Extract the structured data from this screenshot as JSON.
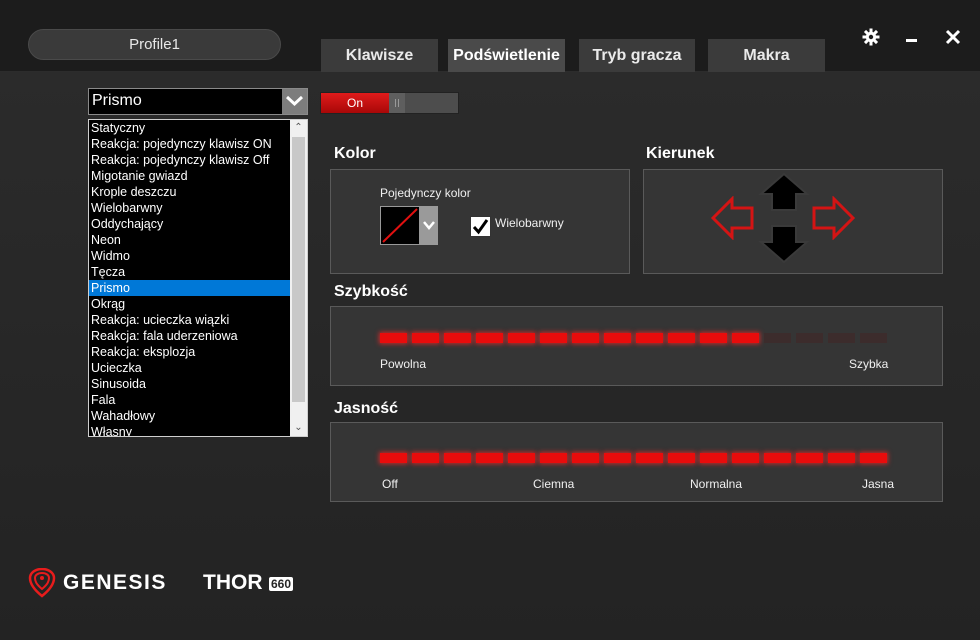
{
  "header": {
    "profile_label": "Profile1",
    "tabs": [
      {
        "label": "Klawisze",
        "active": false
      },
      {
        "label": "Podświetlenie",
        "active": true
      },
      {
        "label": "Tryb gracza",
        "active": false
      },
      {
        "label": "Makra",
        "active": false
      }
    ],
    "window_controls": {
      "settings_icon": "gear-icon",
      "minimize_icon": "minimize-icon",
      "close_icon": "close-icon"
    }
  },
  "effect_select": {
    "value": "Prismo",
    "options": [
      "Statyczny",
      "Reakcja: pojedynczy klawisz ON",
      "Reakcja: pojedynczy klawisz Off",
      "Migotanie gwiazd",
      "Krople deszczu",
      "Wielobarwny",
      "Oddychający",
      "Neon",
      "Widmo",
      "Tęcza",
      "Prismo",
      "Okrąg",
      "Reakcja: ucieczka wiązki",
      "Reakcja: fala uderzeniowa",
      "Reakcja: eksplozja",
      "Ucieczka",
      "Sinusoida",
      "Fala",
      "Wahadłowy",
      "Własny"
    ],
    "selected_index": 10
  },
  "toggle": {
    "label": "On",
    "state": true
  },
  "kolor": {
    "title": "Kolor",
    "single_color_label": "Pojedynczy kolor",
    "multicolor_label": "Wielobarwny",
    "multicolor_checked": true
  },
  "kierunek": {
    "title": "Kierunek",
    "arrows": [
      "up-arrow",
      "down-arrow",
      "left-arrow",
      "right-arrow"
    ]
  },
  "szybkosc": {
    "title": "Szybkość",
    "min_label": "Powolna",
    "max_label": "Szybka",
    "segments_total": 16,
    "segments_lit": 12
  },
  "jasnosc": {
    "title": "Jasność",
    "labels": [
      "Off",
      "Ciemna",
      "Normalna",
      "Jasna"
    ],
    "segments_total": 16,
    "segments_lit": 16
  },
  "brand": {
    "name": "GENESIS",
    "product": "THOR",
    "model": "660"
  },
  "colors": {
    "accent_red": "#e80c0c",
    "select_highlight": "#0078d7",
    "background": "#262626"
  }
}
